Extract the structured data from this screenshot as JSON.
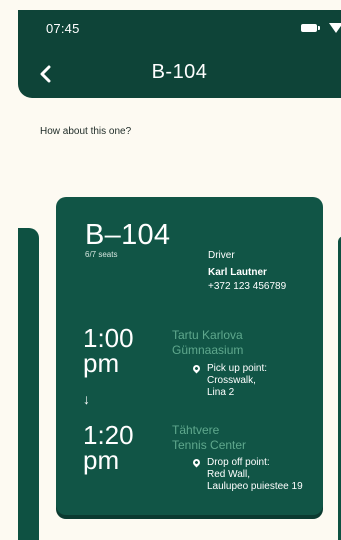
{
  "status_bar": {
    "time": "07:45"
  },
  "header": {
    "title": "B-104"
  },
  "prompt": "How about this one?",
  "card": {
    "bus_code": "B–104",
    "seats": "6/7 seats",
    "driver": {
      "label": "Driver",
      "name": "Karl Lautner",
      "phone": "+372 123 456789"
    },
    "departure": {
      "time_line1": "1:00",
      "time_line2": "pm",
      "place_line1": "Tartu Karlova",
      "place_line2": "Gümnaasium",
      "point_line1": "Pick up point:",
      "point_line2": "Crosswalk,",
      "point_line3": "Lina 2"
    },
    "arrow": "↓",
    "arrival": {
      "time_line1": "1:20",
      "time_line2": "pm",
      "place_line1": "Tähtvere",
      "place_line2": "Tennis Center",
      "point_line1": "Drop off point:",
      "point_line2": "Red Wall,",
      "point_line3": "Laulupeo puiestee 19"
    }
  },
  "colors": {
    "brand_dark": "#0e4438",
    "card": "#115546",
    "place_text": "#5fa88d",
    "background": "#fdfaf2"
  },
  "icons": [
    "back-arrow-icon",
    "battery-icon",
    "wifi-icon",
    "location-pin-icon"
  ]
}
